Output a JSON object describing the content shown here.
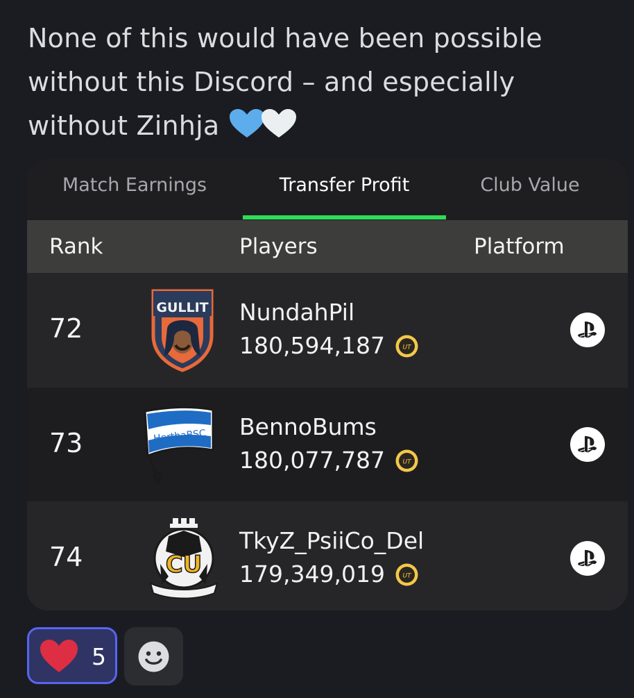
{
  "message": {
    "text": "None of this would have been possible without this Discord – and especially without Zinhja",
    "emojis": [
      "blue-heart-icon",
      "white-heart-icon"
    ]
  },
  "leaderboard": {
    "tabs": [
      {
        "label": "Match Earnings",
        "active": false
      },
      {
        "label": "Transfer Profit",
        "active": true
      },
      {
        "label": "Club Value",
        "active": false
      }
    ],
    "accent_color": "#2ddc57",
    "columns": {
      "rank": "Rank",
      "players": "Players",
      "platform": "Platform"
    },
    "rows": [
      {
        "rank": "72",
        "crest": "gullit-crest-icon",
        "crest_text": "GULLIT",
        "name": "NundahPil",
        "value": "180,594,187",
        "currency_icon": "ut-coin-icon",
        "platform_icon": "playstation-icon"
      },
      {
        "rank": "73",
        "crest": "hertha-bsc-flag-icon",
        "crest_text": "HerthaBSC",
        "name": "BennoBums",
        "value": "180,077,787",
        "currency_icon": "ut-coin-icon",
        "platform_icon": "playstation-icon"
      },
      {
        "rank": "74",
        "crest": "cambridge-united-crest-icon",
        "crest_text": "CU",
        "name": "TkyZ_PsiiCo_Del",
        "value": "179,349,019",
        "currency_icon": "ut-coin-icon",
        "platform_icon": "playstation-icon"
      }
    ],
    "coin_label": "UT"
  },
  "reactions": [
    {
      "emoji": "red-heart-icon",
      "count": "5",
      "selected": true
    },
    {
      "emoji": "add-reaction-icon"
    }
  ]
}
